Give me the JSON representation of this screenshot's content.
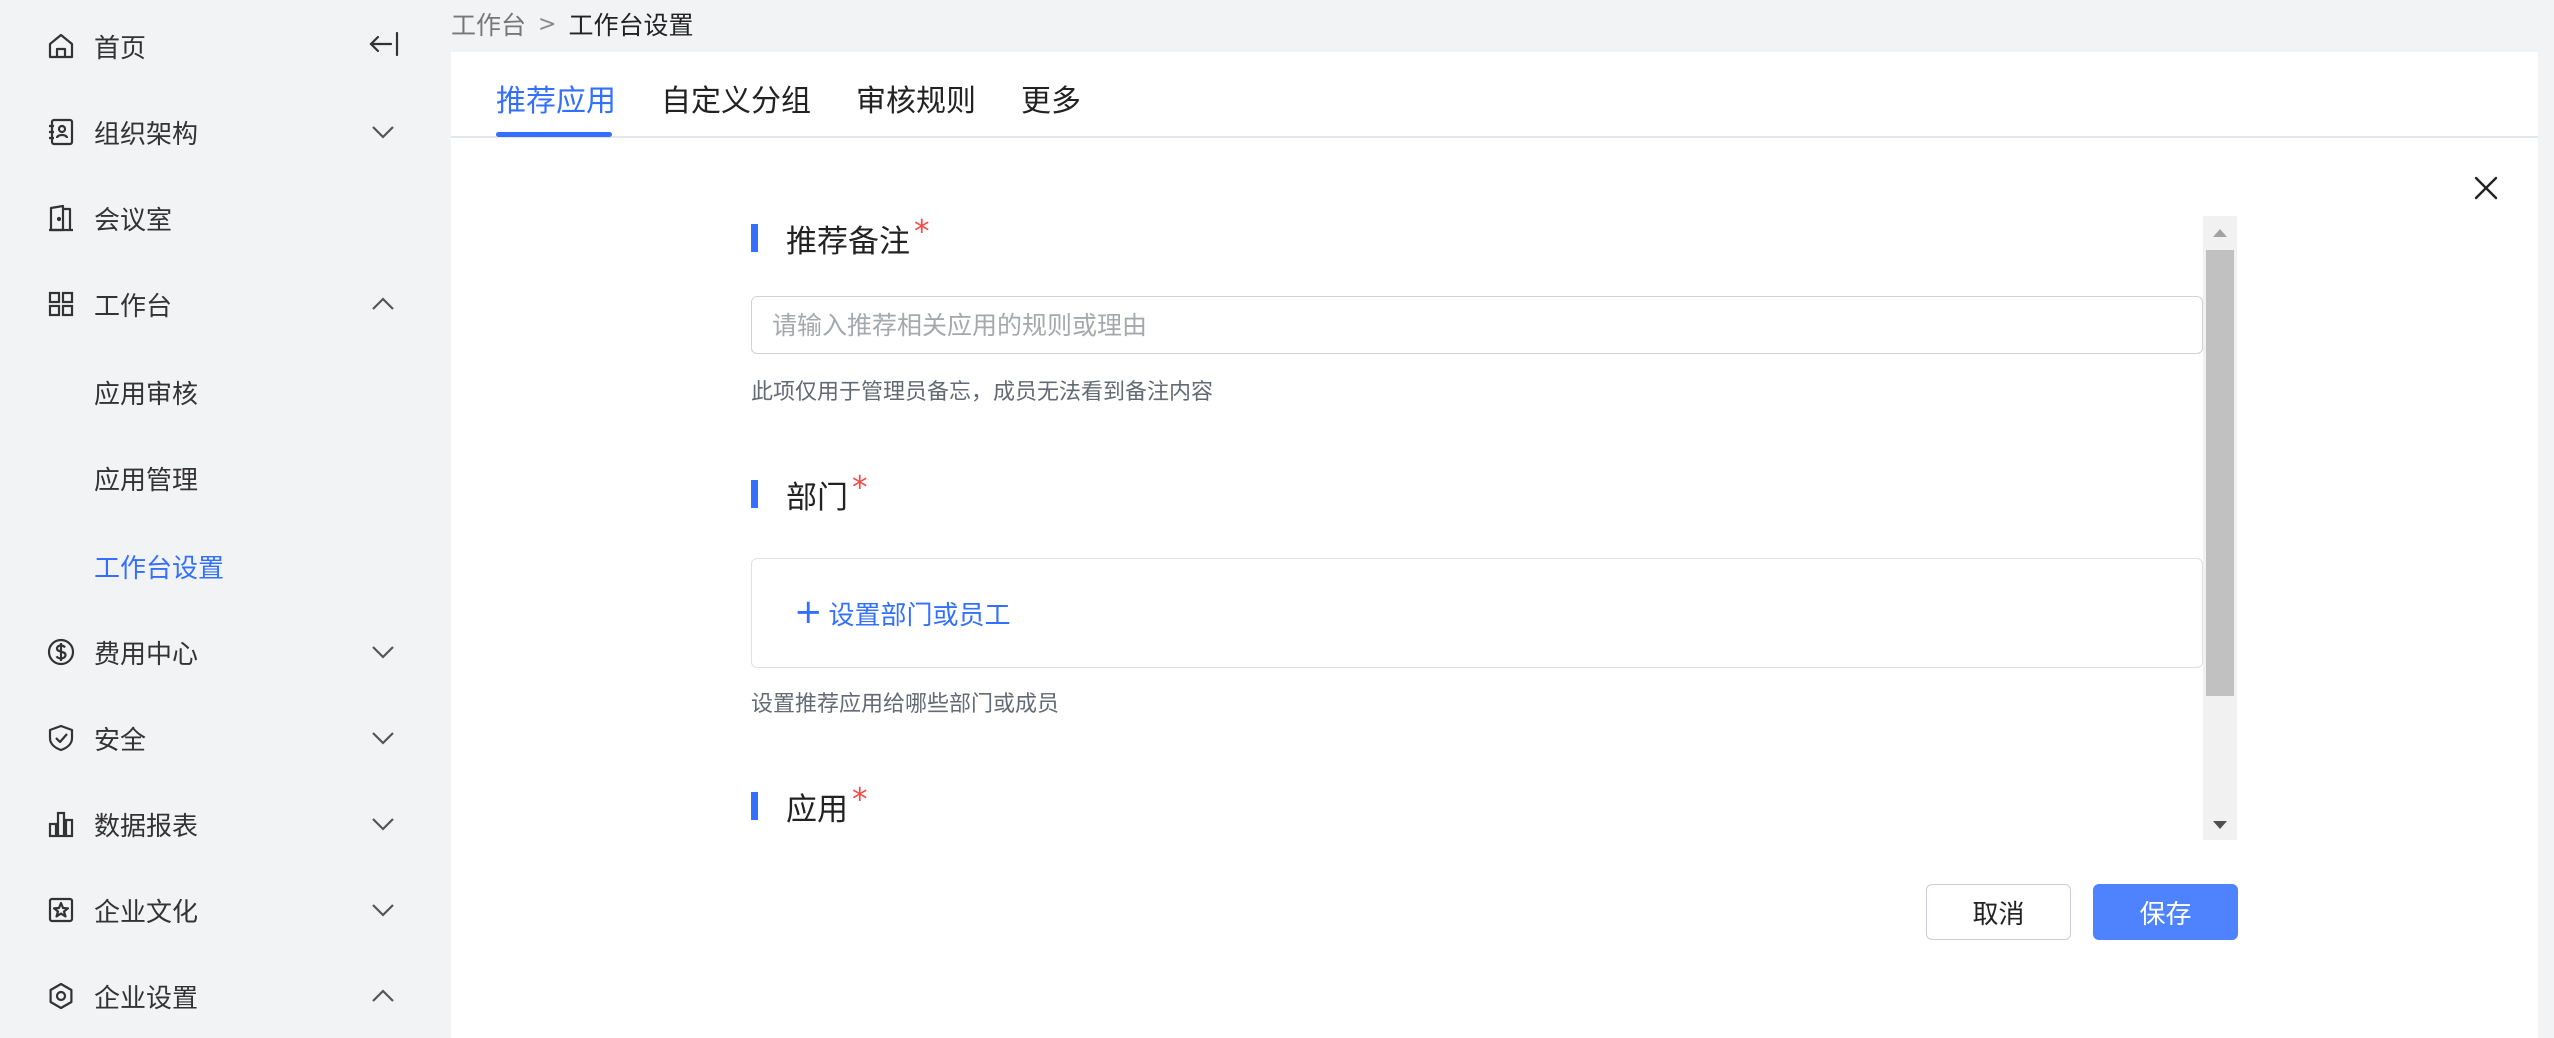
{
  "sidebar": {
    "collapse_icon": "collapse-left-icon",
    "items": [
      {
        "label": "首页",
        "icon": "home-icon"
      },
      {
        "label": "组织架构",
        "icon": "contacts-icon",
        "expanded": false
      },
      {
        "label": "会议室",
        "icon": "door-icon"
      },
      {
        "label": "工作台",
        "icon": "grid-icon",
        "expanded": true
      },
      {
        "label": "应用审核"
      },
      {
        "label": "应用管理"
      },
      {
        "label": "工作台设置",
        "active": true
      },
      {
        "label": "费用中心",
        "icon": "dollar-icon",
        "expanded": false
      },
      {
        "label": "安全",
        "icon": "shield-icon",
        "expanded": false
      },
      {
        "label": "数据报表",
        "icon": "bar-chart-icon",
        "expanded": false
      },
      {
        "label": "企业文化",
        "icon": "star-frame-icon",
        "expanded": false
      },
      {
        "label": "企业设置",
        "icon": "hexagon-settings-icon",
        "expanded": true
      }
    ]
  },
  "breadcrumb": {
    "parent": "工作台",
    "separator": ">",
    "current": "工作台设置"
  },
  "tabs": [
    {
      "label": "推荐应用",
      "active": true
    },
    {
      "label": "自定义分组"
    },
    {
      "label": "审核规则"
    },
    {
      "label": "更多"
    }
  ],
  "form": {
    "note": {
      "title": "推荐备注",
      "required": "*",
      "placeholder": "请输入推荐相关应用的规则或理由",
      "value": "",
      "hint": "此项仅用于管理员备忘，成员无法看到备注内容"
    },
    "department": {
      "title": "部门",
      "required": "*",
      "add_label": "设置部门或员工",
      "add_icon": "+",
      "hint": "设置推荐应用给哪些部门或成员"
    },
    "app": {
      "title": "应用",
      "required": "*"
    }
  },
  "actions": {
    "cancel_label": "取消",
    "save_label": "保存"
  },
  "colors": {
    "accent": "#3370ff",
    "save_button": "#4e83fd",
    "required": "#f54a45",
    "sidebar_bg": "#f2f3f5"
  }
}
